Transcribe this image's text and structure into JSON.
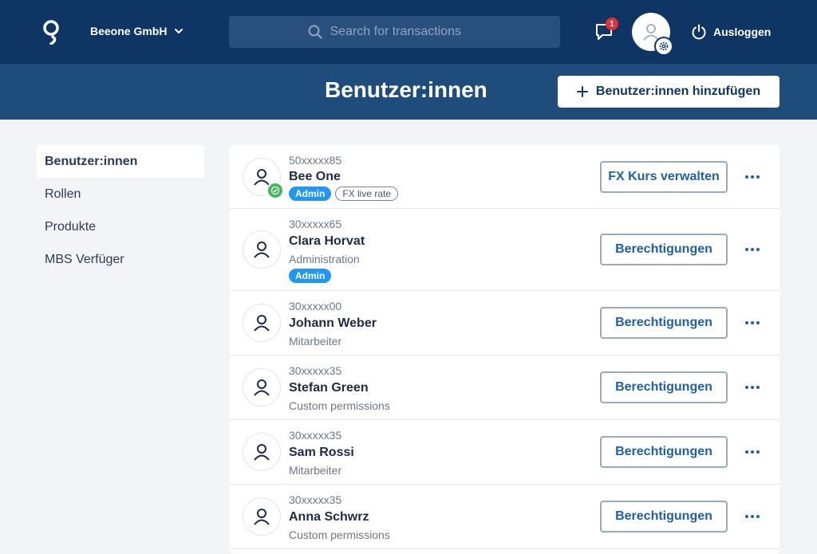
{
  "header": {
    "company": "Beeone GmbH",
    "search_placeholder": "Search for transactions",
    "messages_count": "1",
    "logout_label": "Ausloggen"
  },
  "page": {
    "title": "Benutzer:innen",
    "add_button": "Benutzer:innen hinzufügen"
  },
  "sidebar": {
    "items": [
      {
        "label": "Benutzer:innen",
        "active": true
      },
      {
        "label": "Rollen"
      },
      {
        "label": "Produkte"
      },
      {
        "label": "MBS Verfüger"
      }
    ]
  },
  "users": [
    {
      "account": "50xxxxx85",
      "name": "Bee One",
      "badges": [
        "Admin",
        "FX live rate"
      ],
      "verified": true,
      "action": "FX Kurs verwalten"
    },
    {
      "account": "30xxxxx65",
      "name": "Clara Horvat",
      "role": "Administration",
      "badges": [
        "Admin"
      ],
      "action": "Berechtigungen"
    },
    {
      "account": "30xxxxx00",
      "name": "Johann Weber",
      "role": "Mitarbeiter",
      "action": "Berechtigungen"
    },
    {
      "account": "30xxxxx35",
      "name": "Stefan Green",
      "role": "Custom permissions",
      "action": "Berechtigungen"
    },
    {
      "account": "30xxxxx35",
      "name": "Sam Rossi",
      "role": "Mitarbeiter",
      "action": "Berechtigungen"
    },
    {
      "account": "30xxxxx35",
      "name": "Anna Schwrz",
      "role": "Custom permissions",
      "action": "Berechtigungen"
    }
  ],
  "icons": {
    "logo": "beeone-logo-icon",
    "chevron": "chevron-down-icon",
    "search": "search-icon",
    "messages": "chat-icon",
    "settings": "gear-icon",
    "logout": "power-icon",
    "add": "plus-icon",
    "user": "user-icon",
    "verified": "check-circle-icon",
    "more": "more-horizontal-icon"
  },
  "colors": {
    "header": "#0e3563",
    "band": "#1e4d7c",
    "accent": "#1f5fa6",
    "admin_badge": "#2196f3",
    "verified": "#3fb95a",
    "notification": "#e0303a"
  }
}
